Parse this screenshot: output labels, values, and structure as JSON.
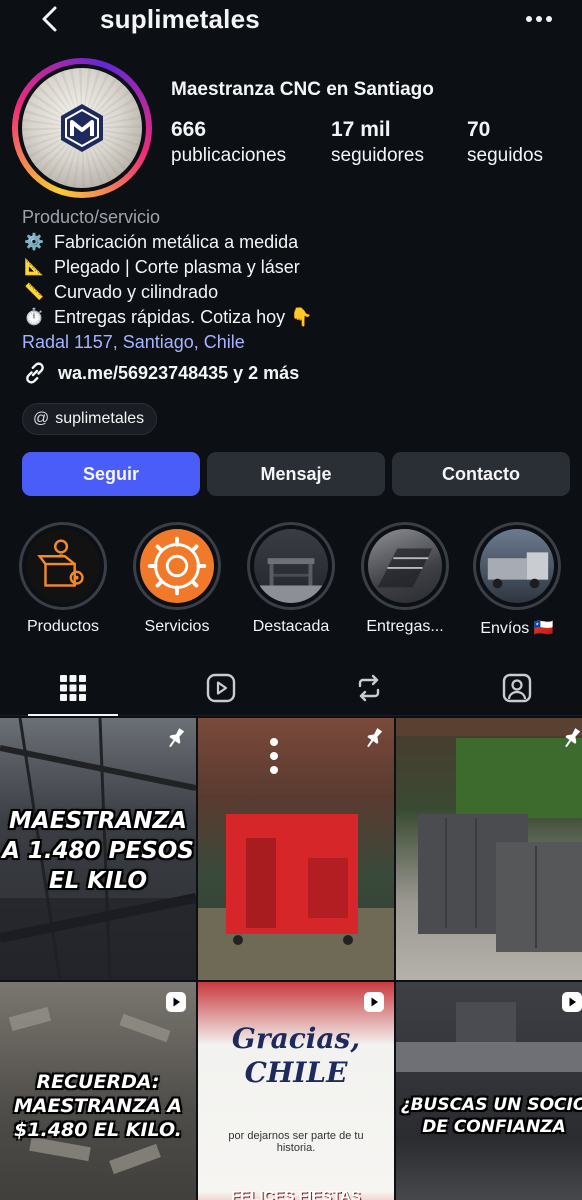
{
  "header": {
    "username": "suplimetales"
  },
  "profile": {
    "name": "Maestranza CNC en Santiago",
    "stats": [
      {
        "value": "666",
        "label": "publicaciones"
      },
      {
        "value": "17 mil",
        "label": "seguidores"
      },
      {
        "value": "70",
        "label": "seguidos"
      }
    ]
  },
  "bio": {
    "category": "Producto/servicio",
    "lines": [
      {
        "icon": "⚙️",
        "text": "Fabricación metálica a medida"
      },
      {
        "icon": "📐",
        "text": "Plegado | Corte plasma y láser"
      },
      {
        "icon": "📏",
        "text": "Curvado y cilindrado"
      },
      {
        "icon": "⏱️",
        "text": "Entregas rápidas. Cotiza hoy 👇"
      }
    ],
    "address": "Radal 1157, Santiago, Chile",
    "link": "wa.me/56923748435 y 2 más",
    "threads": "suplimetales"
  },
  "actions": {
    "follow": "Seguir",
    "message": "Mensaje",
    "contact": "Contacto"
  },
  "highlights": [
    {
      "label": "Productos"
    },
    {
      "label": "Servicios"
    },
    {
      "label": "Destacada"
    },
    {
      "label": "Entregas..."
    },
    {
      "label": "Envíos 🇨🇱"
    }
  ],
  "posts": [
    {
      "text": "MAESTRANZA A 1.480 PESOS EL KILO",
      "badge": "pin"
    },
    {
      "text": "",
      "badge": "pin"
    },
    {
      "text": "",
      "badge": "pin"
    },
    {
      "text": "RECUERDA: MAESTRANZA A $1.480 EL KILO.",
      "badge": "reel"
    },
    {
      "text_main": "Gracias, CHILE",
      "text_sub": "por dejarnos ser parte de tu historia.",
      "text_footer": "FELICES FIESTAS PATRIAS",
      "badge": "reel"
    },
    {
      "text": "¿BUSCAS UN SOCIO DE CONFIANZA",
      "badge": "reel"
    }
  ],
  "colors": {
    "accent": "#4a5df9",
    "secondary_button": "#2a2e35",
    "background": "#0c0f14",
    "address_link": "#a7b3ff"
  }
}
